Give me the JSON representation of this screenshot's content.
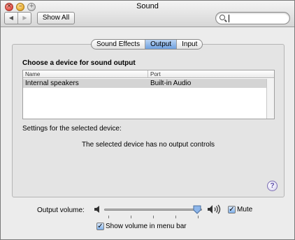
{
  "window": {
    "title": "Sound"
  },
  "toolbar": {
    "show_all_label": "Show All",
    "back_icon": "back-arrow-icon",
    "forward_icon": "forward-arrow-icon"
  },
  "search": {
    "value": "",
    "icon": "search-icon"
  },
  "tabs": [
    {
      "label": "Sound Effects",
      "selected": false
    },
    {
      "label": "Output",
      "selected": true
    },
    {
      "label": "Input",
      "selected": false
    }
  ],
  "pane": {
    "heading": "Choose a device for sound output",
    "table": {
      "columns": [
        "Name",
        "Port"
      ],
      "rows": [
        {
          "name": "Internal speakers",
          "port": "Built-in Audio",
          "selected": true
        }
      ]
    },
    "settings_label": "Settings for the selected device:",
    "no_controls_message": "The selected device has no output controls",
    "help_label": "?"
  },
  "volume": {
    "label": "Output volume:",
    "level": 0.95,
    "quiet_icon": "speaker-quiet-icon",
    "loud_icon": "speaker-loud-icon",
    "mute": {
      "label": "Mute",
      "checked": true
    }
  },
  "menu_bar_option": {
    "label": "Show volume in menu bar",
    "checked": true
  },
  "colors": {
    "selected_tab": "#6fa1e0",
    "selected_row": "#d4d4d4",
    "checkbox": "#7fb0ea"
  }
}
